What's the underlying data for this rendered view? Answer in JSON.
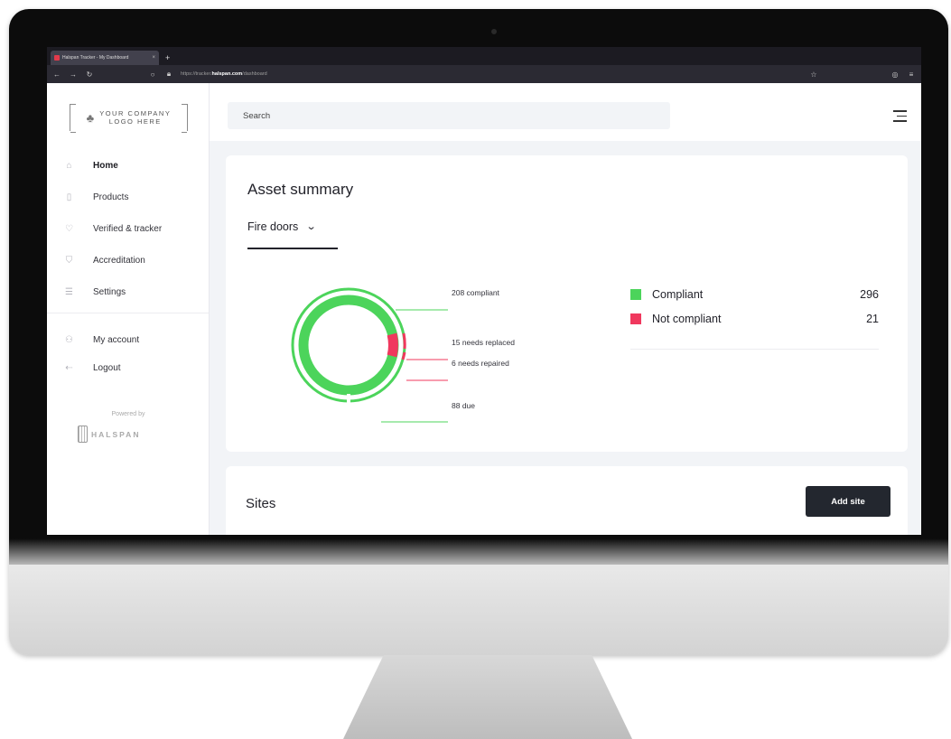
{
  "browser": {
    "tab_title": "Halspan Tracker - My Dashboard",
    "url_prefix": "https://tracker.",
    "url_domain": "halspan.com",
    "url_path": "/dashboard"
  },
  "sidebar": {
    "logo_text_line1": "YOUR COMPANY",
    "logo_text_line2": "LOGO HERE",
    "items": [
      {
        "label": "Home",
        "icon": "home-icon",
        "active": true
      },
      {
        "label": "Products",
        "icon": "door-icon"
      },
      {
        "label": "Verified & tracker",
        "icon": "location-pin-icon"
      },
      {
        "label": "Accreditation",
        "icon": "shield-icon"
      },
      {
        "label": "Settings",
        "icon": "sliders-icon"
      }
    ],
    "account_items": [
      {
        "label": "My account",
        "icon": "user-icon"
      },
      {
        "label": "Logout",
        "icon": "logout-icon"
      }
    ],
    "powered_by": "Powered by",
    "brand": "HALSPAN"
  },
  "header": {
    "search_placeholder": "Search"
  },
  "asset_summary": {
    "title": "Asset summary",
    "selected_category": "Fire doors",
    "callouts": {
      "compliant": "208 compliant",
      "replaced": "15 needs replaced",
      "repaired": "6 needs repaired",
      "due": "88 due"
    },
    "legend": [
      {
        "label": "Compliant",
        "value": "296",
        "color": "#4cd45b"
      },
      {
        "label": "Not compliant",
        "value": "21",
        "color": "#f0385e"
      }
    ]
  },
  "sites": {
    "title": "Sites",
    "add_button": "Add site"
  },
  "colors": {
    "compliant": "#4cd45b",
    "not_compliant": "#f0385e",
    "dark": "#23272f"
  }
}
